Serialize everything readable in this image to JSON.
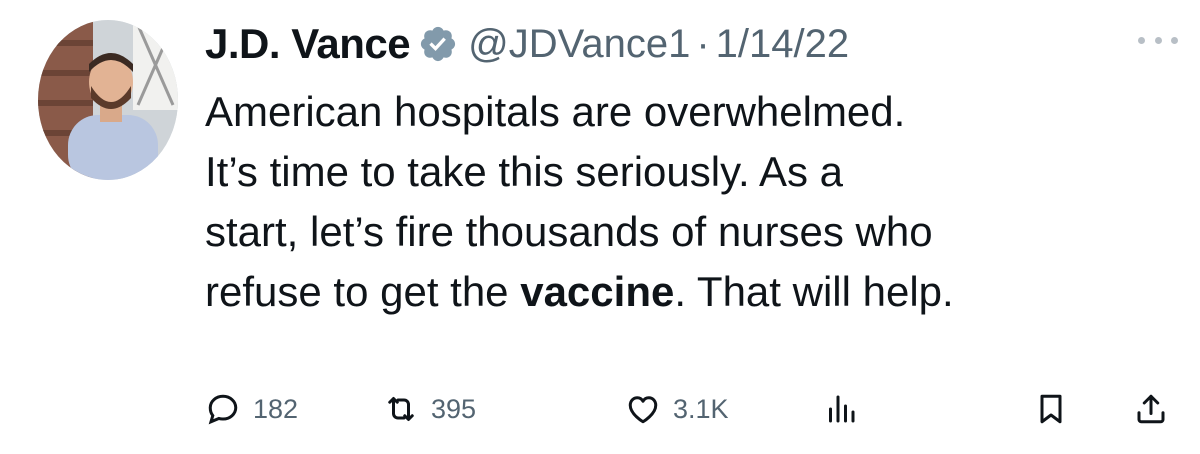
{
  "tweet": {
    "author": {
      "name": "J.D. Vance",
      "handle": "@JDVance1",
      "separator": "·",
      "date": "1/14/22"
    },
    "body": {
      "line1": "American hospitals are overwhelmed.",
      "line2": "It’s time to take this seriously.  As a",
      "line3": "start, let’s fire thousands of nurses who",
      "line4_pre": "refuse to get the ",
      "line4_bold": "vaccine",
      "line4_post": ". That will help."
    },
    "actions": {
      "replies": "182",
      "reposts": "395",
      "likes": "3.1K"
    },
    "icons": {
      "reply": "reply-icon",
      "repost": "repost-icon",
      "like": "like-icon",
      "views": "views-icon",
      "bookmark": "bookmark-icon",
      "share": "share-icon",
      "verified": "verified-badge-icon",
      "more": "more-icon"
    },
    "colors": {
      "text": "#0f1419",
      "secondary": "#536471",
      "badge": "#829aab"
    }
  }
}
